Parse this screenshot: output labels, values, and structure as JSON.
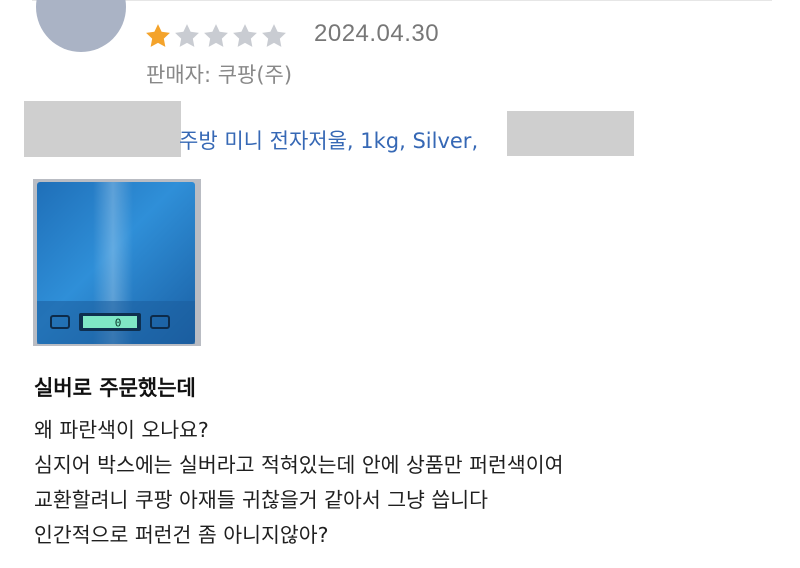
{
  "review": {
    "rating": 1,
    "rating_max": 5,
    "colors": {
      "star_filled": "#F4A32B",
      "star_empty": "#C9CCD2",
      "link": "#3668B5"
    },
    "date": "2024.04.30",
    "seller": "판매자: 쿠팡(주)",
    "product_link": "주방 미니 전자저울, 1kg, Silver,",
    "photo": {
      "description_icon": "blue-kitchen-scale-photo",
      "display_text": "0"
    },
    "headline": "실버로 주문했는데",
    "body_lines": [
      "왜 파란색이 오나요?",
      "심지어 박스에는 실버라고 적혀있는데 안에 상품만 퍼런색이여",
      "교환할려니 쿠팡 아재들 귀찮을거 같아서 그냥 씁니다",
      "인간적으로 퍼런건 좀 아니지않아?"
    ]
  }
}
